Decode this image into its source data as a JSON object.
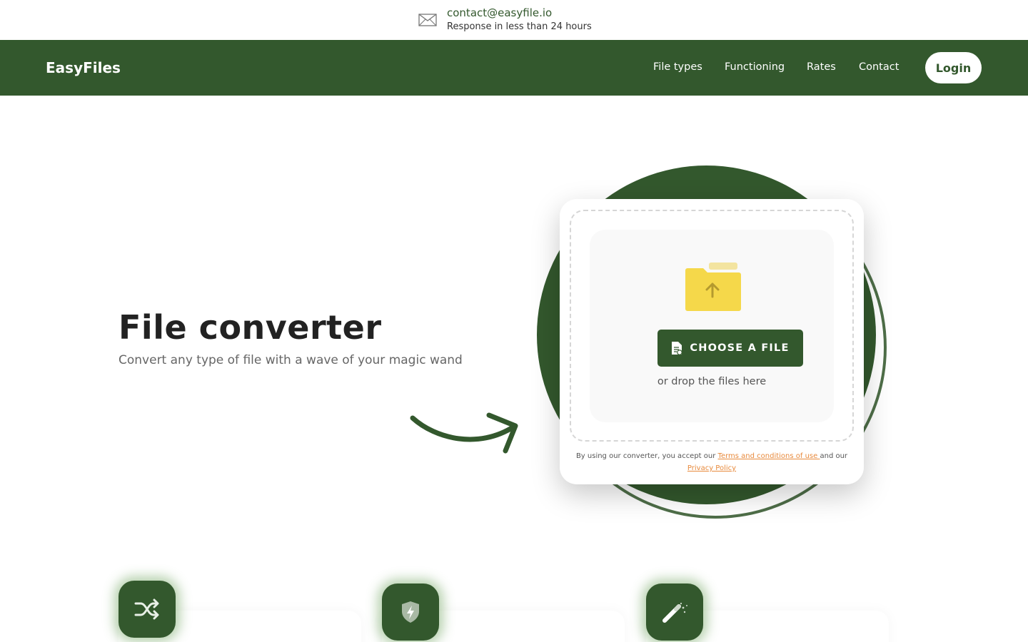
{
  "topbar": {
    "email": "contact@easyfile.io",
    "response": "Response in less than 24 hours",
    "icon": "mail-icon"
  },
  "nav": {
    "brand": "EasyFiles",
    "links": [
      "File types",
      "Functioning",
      "Rates",
      "Contact"
    ],
    "login": "Login"
  },
  "hero": {
    "title": "File converter",
    "subtitle": "Convert any type of file with a wave of your magic wand"
  },
  "uploader": {
    "button": "CHOOSE A FILE",
    "hint": "or drop the files here",
    "legal_prefix": "By using our converter, you accept our ",
    "terms": "Terms and conditions of use ",
    "legal_mid": "and our",
    "privacy": "Privacy Policy",
    "icons": [
      "folder-upload-icon",
      "document-icon"
    ]
  },
  "features": {
    "icons": [
      "shuffle-icon",
      "shield-bolt-icon",
      "magic-wand-icon"
    ]
  },
  "colors": {
    "brand": "#33582d",
    "accent": "#e88a3c",
    "folder": "#f5d84a"
  }
}
